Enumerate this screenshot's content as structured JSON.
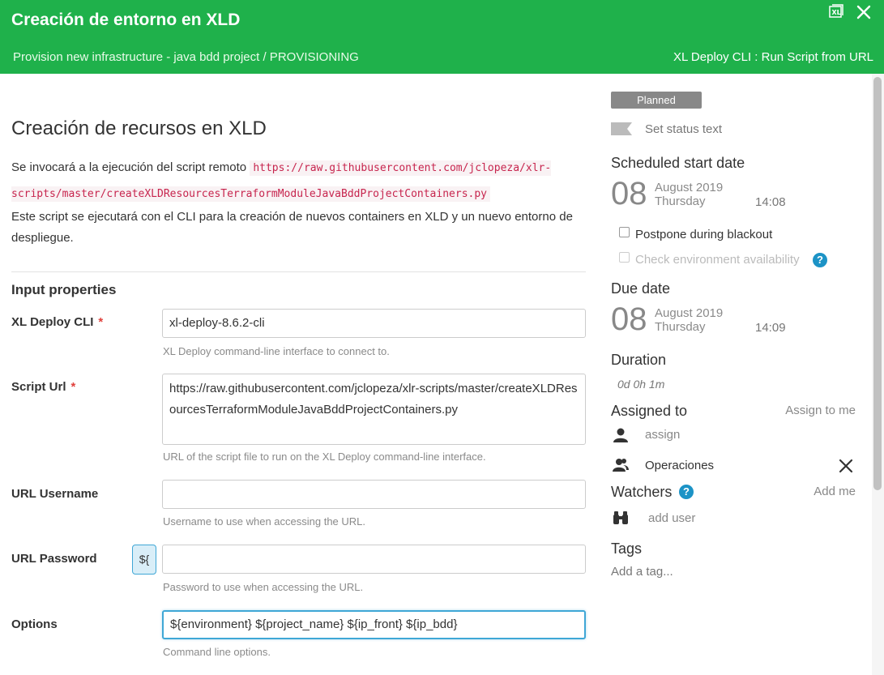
{
  "header": {
    "title": "Creación de entorno en XLD",
    "breadcrumb": "Provision new infrastructure - java bdd project / PROVISIONING",
    "task_type": "XL Deploy CLI : Run Script from URL"
  },
  "main": {
    "title": "Creación de recursos en XLD",
    "desc1_prefix": "Se invocará a la ejecución del script remoto",
    "desc1_url": "https://raw.githubusercontent.com/jclopeza/xlr-scripts/master/createXLDResourcesTerraformModuleJavaBddProjectContainers.py",
    "desc2": "Este script se ejecutará con el CLI para la creación de nuevos containers en XLD y un nuevo entorno de despliegue.",
    "input_properties": "Input properties",
    "required_mark": "*",
    "var_button": "${",
    "fields": [
      {
        "label": "XL Deploy CLI",
        "value": "xl-deploy-8.6.2-cli",
        "help": "XL Deploy command-line interface to connect to."
      },
      {
        "label": "Script Url",
        "value": "https://raw.githubusercontent.com/jclopeza/xlr-scripts/master/createXLDResourcesTerraformModuleJavaBddProjectContainers.py",
        "help": "URL of the script file to run on the XL Deploy command-line interface."
      },
      {
        "label": "URL Username",
        "value": "",
        "help": "Username to use when accessing the URL."
      },
      {
        "label": "URL Password",
        "value": "",
        "help": "Password to use when accessing the URL."
      },
      {
        "label": "Options",
        "value": "${environment} ${project_name} ${ip_front} ${ip_bdd}",
        "help": "Command line options."
      }
    ]
  },
  "side": {
    "status": "Planned",
    "set_status_text": "Set status text",
    "scheduled_start": {
      "heading": "Scheduled start date",
      "day": "08",
      "month_year": "August 2019",
      "weekday": "Thursday",
      "time": "14:08"
    },
    "postpone_label": "Postpone during blackout",
    "check_env_label": "Check environment availability",
    "help_mark": "?",
    "due_date": {
      "heading": "Due date",
      "day": "08",
      "month_year": "August 2019",
      "weekday": "Thursday",
      "time": "14:09"
    },
    "duration_heading": "Duration",
    "duration_value": "0d 0h 1m",
    "assigned_heading": "Assigned to",
    "assign_to_me": "Assign to me",
    "assign_placeholder": "assign",
    "team": "Operaciones",
    "watchers_heading": "Watchers",
    "add_me": "Add me",
    "add_user": "add user",
    "tags_heading": "Tags",
    "add_tag": "Add a tag..."
  },
  "colors": {
    "header_bg": "#1fb14b",
    "status_badge": "#888888",
    "required": "#e0413c",
    "help_badge": "#1c93c6",
    "code_text": "#c7254e"
  }
}
